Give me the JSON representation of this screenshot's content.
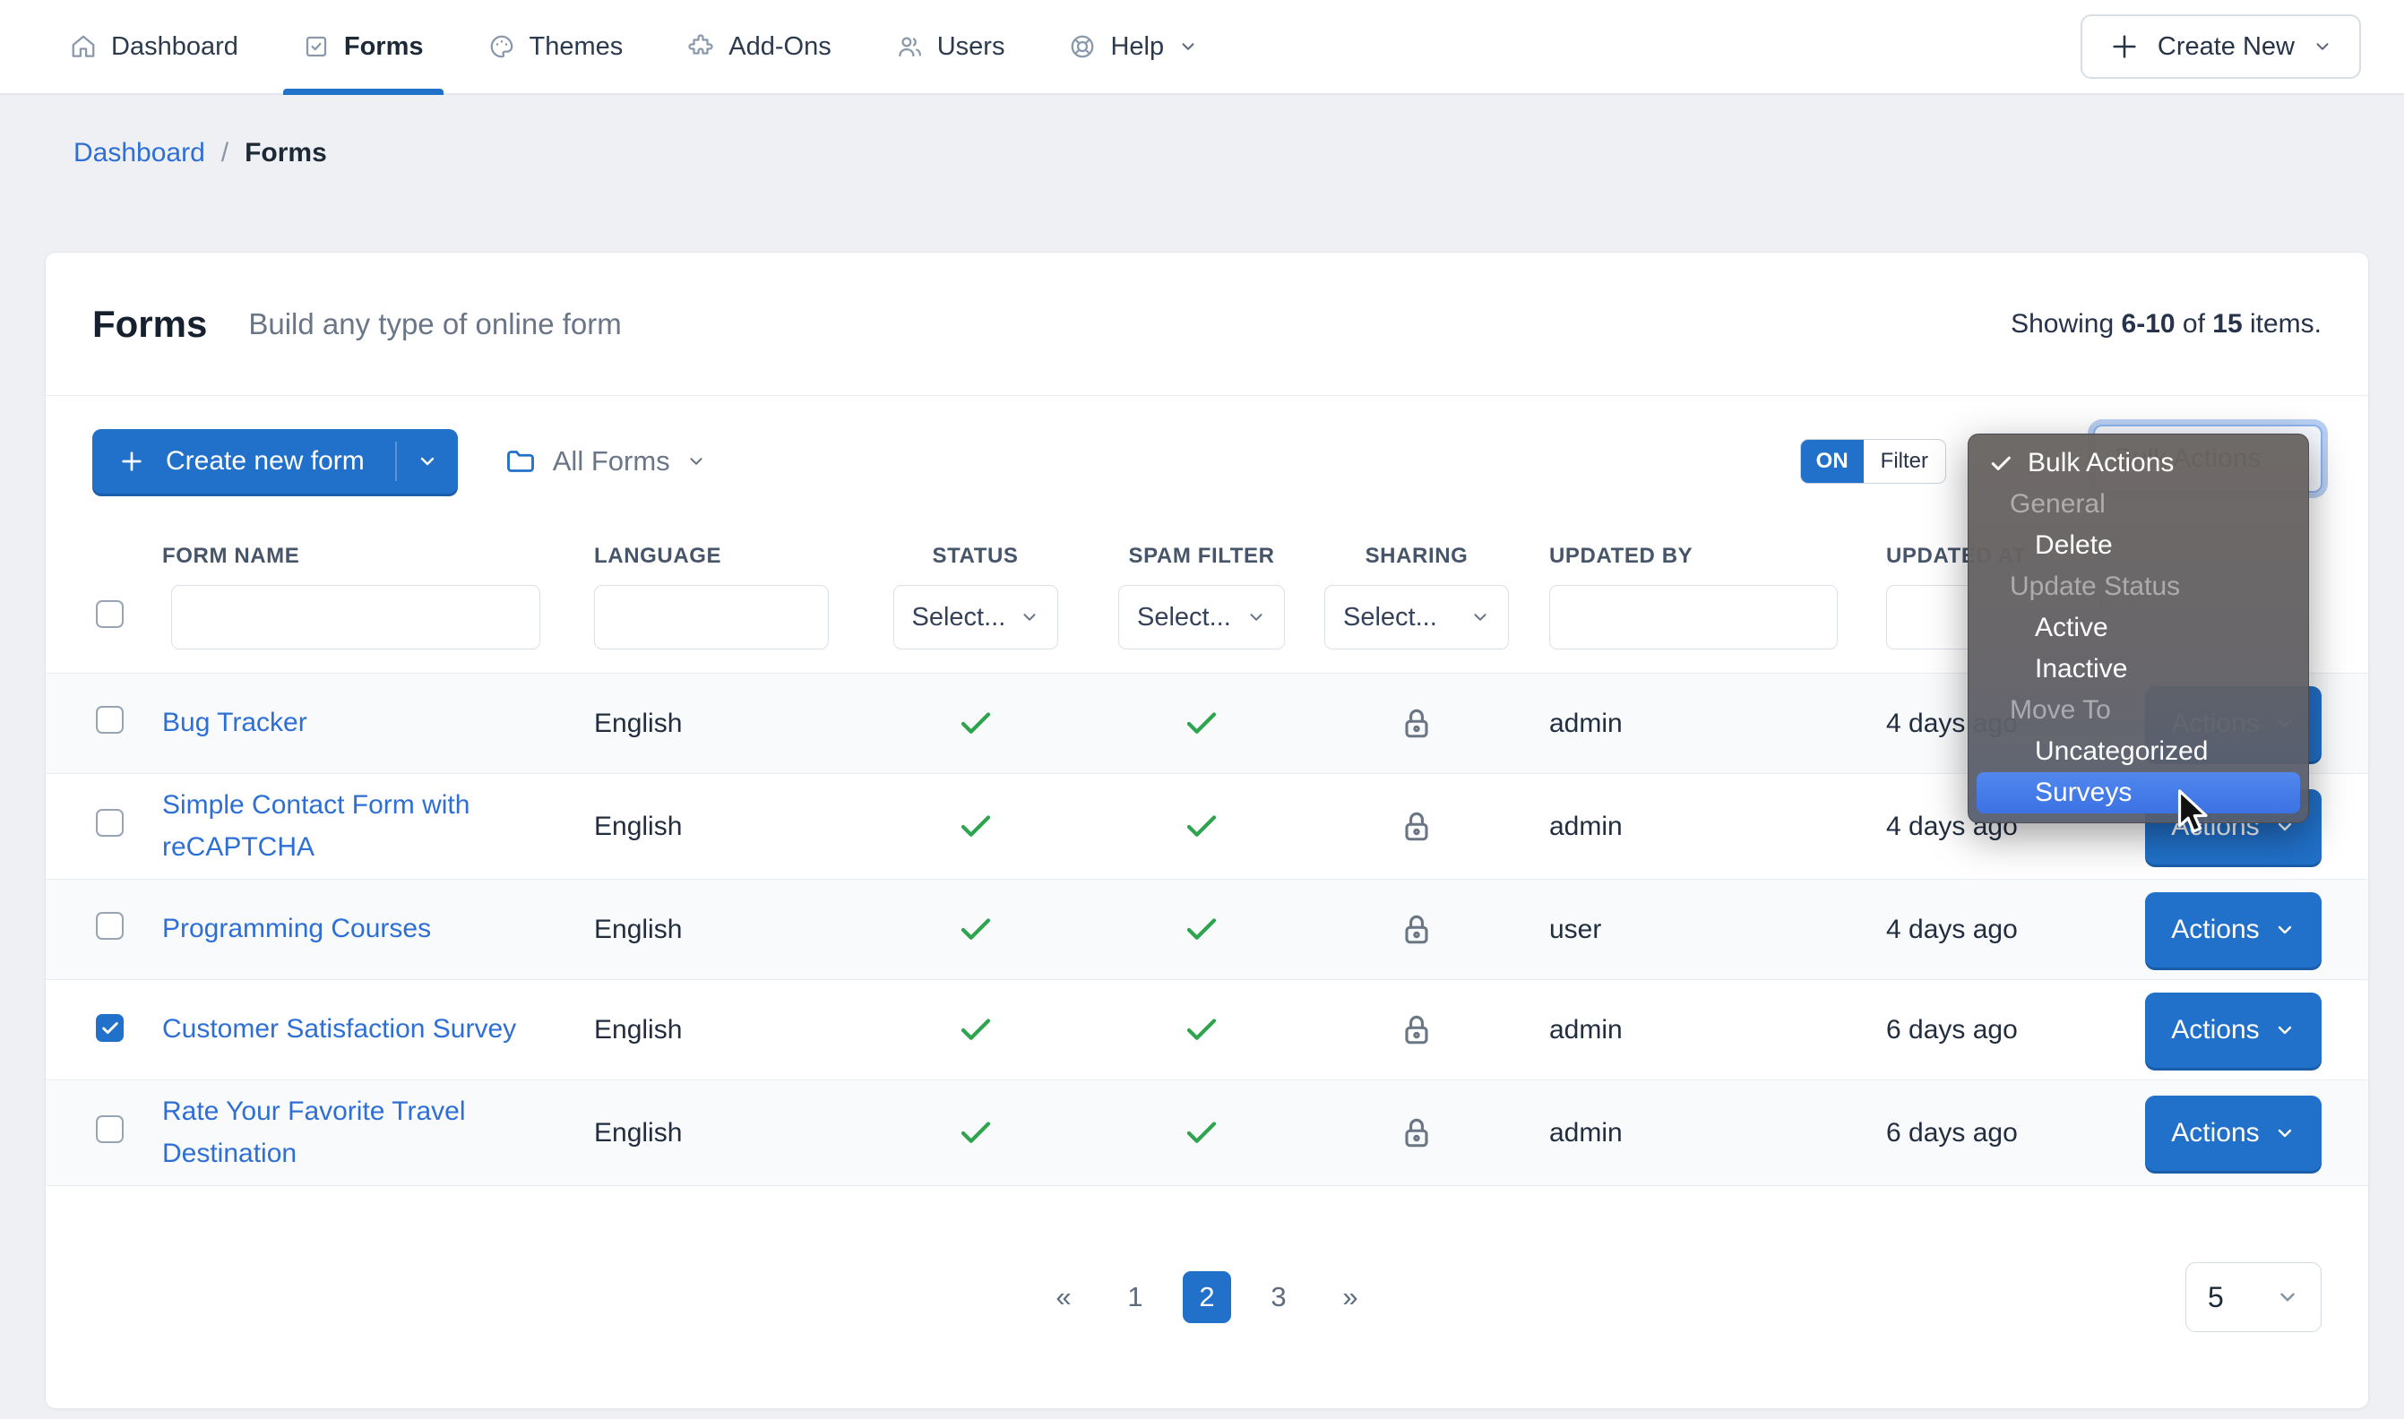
{
  "nav": {
    "items": [
      {
        "label": "Dashboard",
        "icon": "home"
      },
      {
        "label": "Forms",
        "icon": "check-square",
        "active": true
      },
      {
        "label": "Themes",
        "icon": "palette"
      },
      {
        "label": "Add-Ons",
        "icon": "puzzle"
      },
      {
        "label": "Users",
        "icon": "users"
      },
      {
        "label": "Help",
        "icon": "life-ring"
      }
    ],
    "create_new_label": "Create New"
  },
  "breadcrumb": {
    "link": "Dashboard",
    "separator": "/",
    "current": "Forms"
  },
  "header": {
    "title": "Forms",
    "subtitle": "Build any type of online form",
    "showing_prefix": "Showing ",
    "range": "6-10",
    "of_text": " of ",
    "total": "15",
    "items_suffix": " items."
  },
  "toolbar": {
    "create_form_label": "Create new form",
    "folder_filter_label": "All Forms",
    "toggle_on": "ON",
    "toggle_filter": "Filter",
    "bulk_select_value": "Bulk Actions"
  },
  "menu": {
    "items": [
      {
        "label": "Bulk Actions",
        "type": "selected"
      },
      {
        "label": "General",
        "type": "header"
      },
      {
        "label": "Delete",
        "type": "item"
      },
      {
        "label": "Update Status",
        "type": "header"
      },
      {
        "label": "Active",
        "type": "item"
      },
      {
        "label": "Inactive",
        "type": "item"
      },
      {
        "label": "Move To",
        "type": "header"
      },
      {
        "label": "Uncategorized",
        "type": "item"
      },
      {
        "label": "Surveys",
        "type": "item",
        "highlighted": true
      }
    ]
  },
  "table": {
    "columns": {
      "form_name": "FORM NAME",
      "language": "LANGUAGE",
      "status": "STATUS",
      "spam_filter": "SPAM FILTER",
      "sharing": "SHARING",
      "updated_by": "UPDATED BY",
      "updated_at": "UPDATED AT"
    },
    "select_placeholder": "Select...",
    "actions_label": "Actions",
    "rows": [
      {
        "name": "Bug Tracker",
        "language": "English",
        "status": "check",
        "spam": "check",
        "sharing": "lock",
        "updated_by": "admin",
        "updated_at": "4 days ago",
        "checked": false
      },
      {
        "name": "Simple Contact Form with reCAPTCHA",
        "language": "English",
        "status": "check",
        "spam": "check",
        "sharing": "lock",
        "updated_by": "admin",
        "updated_at": "4 days ago",
        "checked": false
      },
      {
        "name": "Programming Courses",
        "language": "English",
        "status": "check",
        "spam": "check",
        "sharing": "lock",
        "updated_by": "user",
        "updated_at": "4 days ago",
        "checked": false
      },
      {
        "name": "Customer Satisfaction Survey",
        "language": "English",
        "status": "check",
        "spam": "check",
        "sharing": "lock",
        "updated_by": "admin",
        "updated_at": "6 days ago",
        "checked": true
      },
      {
        "name": "Rate Your Favorite Travel Destination",
        "language": "English",
        "status": "check",
        "spam": "check",
        "sharing": "lock",
        "updated_by": "admin",
        "updated_at": "6 days ago",
        "checked": false
      }
    ]
  },
  "pagination": {
    "prev": "«",
    "pages": [
      "1",
      "2",
      "3"
    ],
    "active_page": "2",
    "next": "»",
    "page_size": "5"
  },
  "colors": {
    "primary_blue": "#2170c9",
    "link_blue": "#2e6fd6",
    "check_green": "#2ea44f",
    "menu_highlight": "#3c72e3",
    "page_background": "#eef0f4"
  }
}
